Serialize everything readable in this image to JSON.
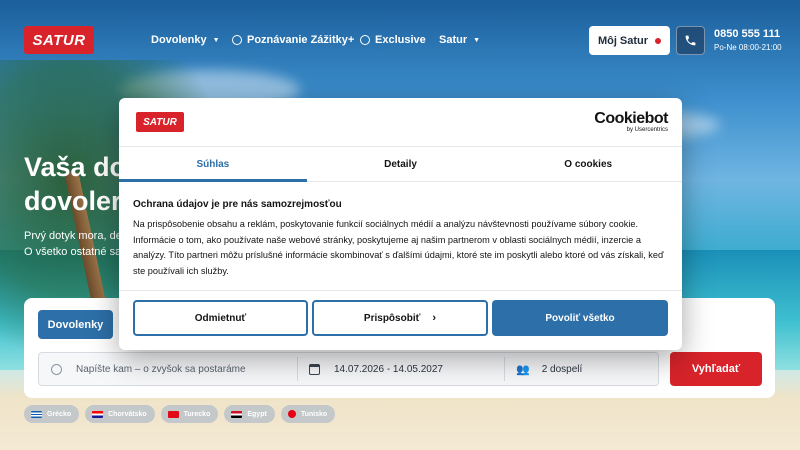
{
  "header": {
    "logo_text": "SATUR",
    "nav": [
      {
        "label": "Dovolenky",
        "has_caret": true
      },
      {
        "label": "Poznávanie Zážitky+",
        "icon": "globe-icon"
      },
      {
        "label": "Exclusive",
        "icon": "globe-icon"
      },
      {
        "label": "Satur",
        "has_caret": true
      }
    ],
    "account_label": "Môj Satur",
    "phone_number": "0850 555 111",
    "phone_hours": "Po-Ne 08:00-21:00"
  },
  "hero": {
    "title": "Vaša do\ndovoler",
    "subtitle": "Prvý dotyk mora, de\nO všetko ostatné sa"
  },
  "search": {
    "active_tab": "Dovolenky",
    "destination_placeholder": "Napíšte kam – o zvyšok sa postaráme",
    "dates": "14.07.2026 - 14.05.2027",
    "travellers": "2 dospelí",
    "submit_label": "Vyhľadať"
  },
  "chips": [
    {
      "label": "Grécko",
      "colors": [
        "#0d5eaf",
        "#ffffff"
      ]
    },
    {
      "label": "Chorvátsko",
      "colors": [
        "#ff0000",
        "#ffffff",
        "#171796"
      ]
    },
    {
      "label": "Turecko",
      "colors": [
        "#e30a17",
        "#e30a17"
      ]
    },
    {
      "label": "Egypt",
      "colors": [
        "#ce1126",
        "#ffffff",
        "#000000"
      ]
    },
    {
      "label": "Tunisko",
      "colors": [
        "#e70013",
        "#e70013"
      ]
    }
  ],
  "cookie_dialog": {
    "logo_text": "SATUR",
    "brand": "Cookiebot",
    "brand_by": "by Usercentrics",
    "tabs": [
      "Súhlas",
      "Detaily",
      "O cookies"
    ],
    "active_tab": "Súhlas",
    "heading": "Ochrana údajov je pre nás samozrejmosťou",
    "body": "Na prispôsobenie obsahu a reklám, poskytovanie funkcií sociálnych médií a analýzu návštevnosti používame súbory cookie. Informácie o tom, ako používate naše webové stránky, poskytujeme aj našim partnerom v oblasti sociálnych médií, inzercie a analýzy. Títo partneri môžu príslušné informácie skombinovať s ďalšími údajmi, ktoré ste im poskytli alebo ktoré od vás získali, keď ste používali ich služby.",
    "buttons": {
      "reject": "Odmietnuť",
      "customize": "Prispôsobiť",
      "allow_all": "Povoliť všetko"
    }
  },
  "colors": {
    "brand_red": "#d8232a",
    "accent_blue": "#2d6fa8"
  }
}
